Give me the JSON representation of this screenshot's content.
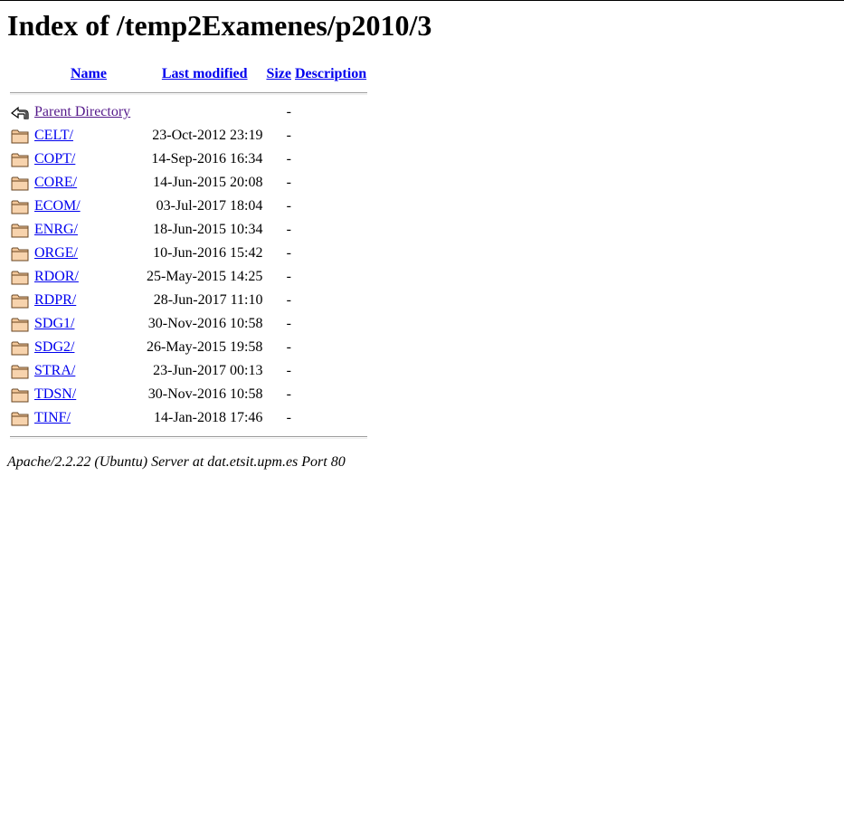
{
  "page": {
    "title": "Index of /temp2Examenes/p2010/3"
  },
  "columns": {
    "name": "Name",
    "last_modified": "Last modified",
    "size": "Size",
    "description": "Description"
  },
  "parent": {
    "label": "Parent Directory",
    "size": "-"
  },
  "entries": [
    {
      "name": "CELT/",
      "modified": "23-Oct-2012 23:19",
      "size": "-"
    },
    {
      "name": "COPT/",
      "modified": "14-Sep-2016 16:34",
      "size": "-"
    },
    {
      "name": "CORE/",
      "modified": "14-Jun-2015 20:08",
      "size": "-"
    },
    {
      "name": "ECOM/",
      "modified": "03-Jul-2017 18:04",
      "size": "-"
    },
    {
      "name": "ENRG/",
      "modified": "18-Jun-2015 10:34",
      "size": "-"
    },
    {
      "name": "ORGE/",
      "modified": "10-Jun-2016 15:42",
      "size": "-"
    },
    {
      "name": "RDOR/",
      "modified": "25-May-2015 14:25",
      "size": "-"
    },
    {
      "name": "RDPR/",
      "modified": "28-Jun-2017 11:10",
      "size": "-"
    },
    {
      "name": "SDG1/",
      "modified": "30-Nov-2016 10:58",
      "size": "-"
    },
    {
      "name": "SDG2/",
      "modified": "26-May-2015 19:58",
      "size": "-"
    },
    {
      "name": "STRA/",
      "modified": "23-Jun-2017 00:13",
      "size": "-"
    },
    {
      "name": "TDSN/",
      "modified": "30-Nov-2016 10:58",
      "size": "-"
    },
    {
      "name": "TINF/",
      "modified": "14-Jan-2018 17:46",
      "size": "-"
    }
  ],
  "footer": {
    "server": "Apache/2.2.22 (Ubuntu) Server at dat.etsit.upm.es Port 80"
  },
  "icons": {
    "folder": "folder-icon",
    "back": "back-arrow-icon"
  },
  "colors": {
    "link": "#0000ee",
    "visited": "#551a8b",
    "folder_fill": "#f4c89a"
  }
}
